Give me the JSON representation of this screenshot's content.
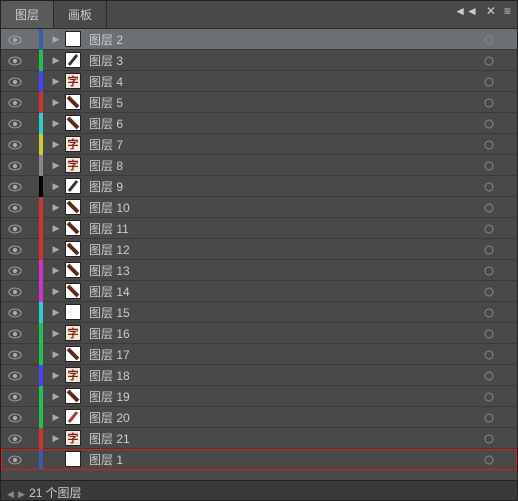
{
  "tabs": {
    "layers": "图层",
    "artboards": "画板"
  },
  "layer_prefix": "图层",
  "status": {
    "count": 21,
    "unit": "个图层"
  },
  "layers": [
    {
      "num": 2,
      "color": "#3a5aaa",
      "selected": true,
      "expandable": true,
      "thumb_bg": "#ffffff"
    },
    {
      "num": 3,
      "color": "#22c050",
      "selected": false,
      "expandable": true,
      "thumb_bg": "#ffffff",
      "thumb_icon": "stroke"
    },
    {
      "num": 4,
      "color": "#4444ff",
      "selected": false,
      "expandable": true,
      "thumb_bg": "#f0e8d8",
      "thumb_icon": "char_red"
    },
    {
      "num": 5,
      "color": "#cc3333",
      "selected": false,
      "expandable": true,
      "thumb_bg": "#ffffff",
      "thumb_icon": "diag"
    },
    {
      "num": 6,
      "color": "#33cccc",
      "selected": false,
      "expandable": true,
      "thumb_bg": "#ffffff",
      "thumb_icon": "diag"
    },
    {
      "num": 7,
      "color": "#cccc33",
      "selected": false,
      "expandable": true,
      "thumb_bg": "#f0e8d8",
      "thumb_icon": "char_red"
    },
    {
      "num": 8,
      "color": "#888888",
      "selected": false,
      "expandable": true,
      "thumb_bg": "#f0e8d8",
      "thumb_icon": "char_red"
    },
    {
      "num": 9,
      "color": "#000000",
      "selected": false,
      "expandable": true,
      "thumb_bg": "#ffffff",
      "thumb_icon": "stroke"
    },
    {
      "num": 10,
      "color": "#cc3333",
      "selected": false,
      "expandable": true,
      "thumb_bg": "#ffffff",
      "thumb_icon": "diag"
    },
    {
      "num": 11,
      "color": "#cc3333",
      "selected": false,
      "expandable": true,
      "thumb_bg": "#ffffff",
      "thumb_icon": "diag"
    },
    {
      "num": 12,
      "color": "#cc3333",
      "selected": false,
      "expandable": true,
      "thumb_bg": "#ffffff",
      "thumb_icon": "diag"
    },
    {
      "num": 13,
      "color": "#cc33cc",
      "selected": false,
      "expandable": true,
      "thumb_bg": "#ffffff",
      "thumb_icon": "diag"
    },
    {
      "num": 14,
      "color": "#cc33cc",
      "selected": false,
      "expandable": true,
      "thumb_bg": "#ffffff",
      "thumb_icon": "diag"
    },
    {
      "num": 15,
      "color": "#33cccc",
      "selected": false,
      "expandable": true,
      "thumb_bg": "#ffffff"
    },
    {
      "num": 16,
      "color": "#22c050",
      "selected": false,
      "expandable": true,
      "thumb_bg": "#f0e8d8",
      "thumb_icon": "char_red"
    },
    {
      "num": 17,
      "color": "#22c050",
      "selected": false,
      "expandable": true,
      "thumb_bg": "#ffffff",
      "thumb_icon": "diag"
    },
    {
      "num": 18,
      "color": "#4444ff",
      "selected": false,
      "expandable": true,
      "thumb_bg": "#f0e8d8",
      "thumb_icon": "char_red"
    },
    {
      "num": 19,
      "color": "#22c050",
      "selected": false,
      "expandable": true,
      "thumb_bg": "#ffffff",
      "thumb_icon": "diag"
    },
    {
      "num": 20,
      "color": "#22c050",
      "selected": false,
      "expandable": true,
      "thumb_bg": "#ffffff",
      "thumb_icon": "stroke_red"
    },
    {
      "num": 21,
      "color": "#cc3333",
      "selected": false,
      "expandable": true,
      "thumb_bg": "#f0e8d8",
      "thumb_icon": "char_red"
    },
    {
      "num": 1,
      "color": "#3a5aaa",
      "selected": false,
      "expandable": false,
      "thumb_bg": "#ffffff",
      "highlight_box": true
    }
  ]
}
